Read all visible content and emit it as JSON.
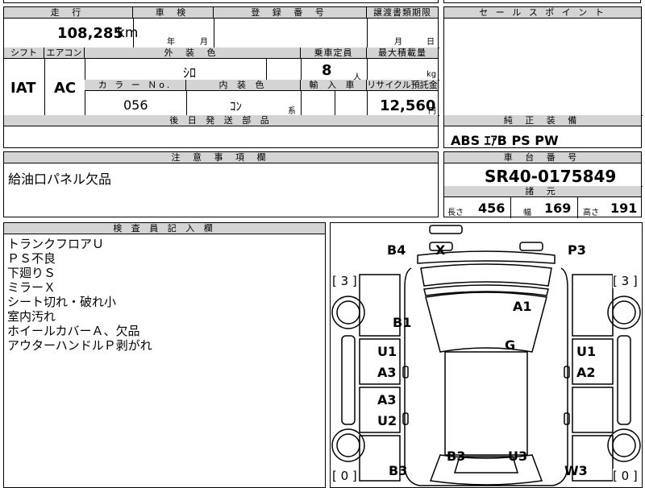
{
  "headers": {
    "mileage": "走 行",
    "inspection": "車 検",
    "registration": "登 録 番 号",
    "transfer_deadline": "譲渡書類期限",
    "sales_point": "セ ー ル ス ポ イ ン ト",
    "shift": "シフト",
    "aircon": "エアコン",
    "exterior_color": "外 装 色",
    "capacity": "乗車定員",
    "max_load": "最大積載量",
    "color_no": "カ ラ ー Ｎo.",
    "interior_color": "内 装 色",
    "import": "輸 入 車",
    "recycle_fee": "リサイクル預託金",
    "after_parts": "後 日 発 送 部 品",
    "equipment": "純 正 装 備",
    "notes": "注 意 事 項 欄",
    "chassis_no": "車 台 番 号",
    "specs": "諸 元",
    "inspector": "検 査 員 記 入 欄"
  },
  "vehicle": {
    "mileage": "108,285",
    "mileage_unit": "km",
    "year_label": "年",
    "month_label": "月",
    "day_label": "日",
    "shift": "IAT",
    "aircon": "AC",
    "exterior_color": "ｼﾛ",
    "capacity": "8",
    "capacity_unit": "人",
    "load_unit": "kg",
    "color_no": "056",
    "interior_color": "ｺﾝ",
    "interior_suffix": "系",
    "recycle_fee": "12,560",
    "recycle_unit": "円",
    "equipment": "ABS ｴｱB PS PW",
    "chassis_no": "SR40-0175849",
    "length_label": "長さ",
    "length": "456",
    "width_label": "幅",
    "width": "169",
    "height_label": "高さ",
    "height": "191"
  },
  "notes_text": "給油口パネル欠品",
  "inspector_lines": [
    "トランクフロアＵ",
    "ＰＳ不良",
    "下廻りＳ",
    "ミラーＸ",
    "シート切れ・破れ小",
    "室内汚れ",
    "ホイールカバーＡ、欠品",
    "アウターハンドルＰ剥がれ"
  ],
  "diagram": {
    "labels": [
      "B4",
      "X",
      "P3",
      "A1",
      "B1",
      "G",
      "U1",
      "A3",
      "U1",
      "A2",
      "A3",
      "U2",
      "B3",
      "U3",
      "B3",
      "W3"
    ],
    "tires": [
      "[ 3 ]",
      "[ 3 ]",
      "[ 0 ]",
      "[ 0 ]"
    ]
  }
}
